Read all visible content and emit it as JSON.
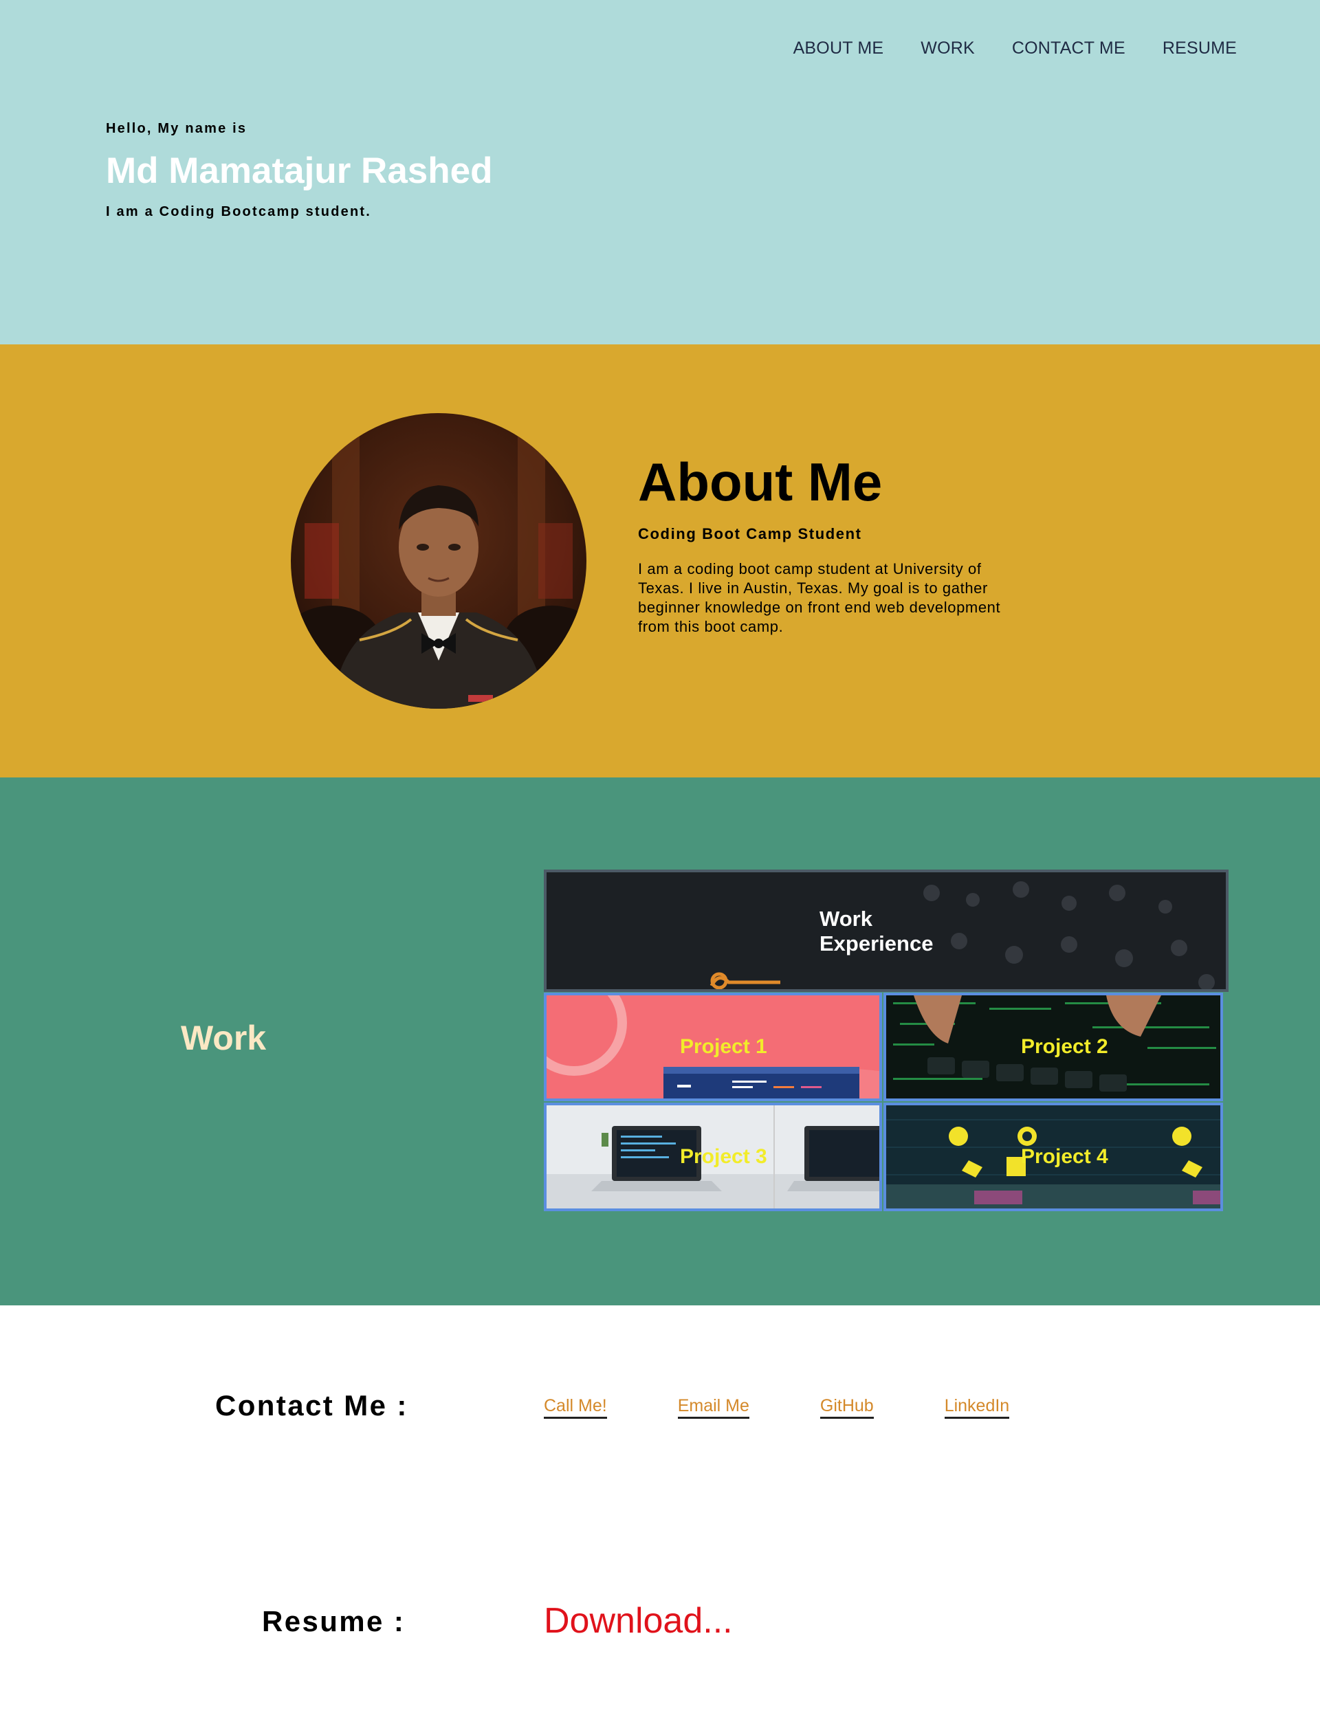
{
  "nav": {
    "items": [
      "ABOUT ME",
      "WORK",
      "CONTACT ME",
      "RESUME"
    ]
  },
  "hero": {
    "greeting": "Hello, My name is",
    "name": "Md Mamatajur Rashed",
    "tagline": "I am a Coding Bootcamp student."
  },
  "about": {
    "title": "About Me",
    "subtitle": "Coding Boot Camp Student",
    "text": "I am a coding boot camp student at University of Texas. I live in Austin, Texas. My goal is to gather beginner knowledge on front end web development from this boot camp."
  },
  "work": {
    "title": "Work",
    "experience_label": "Work Experience",
    "projects": [
      "Project 1",
      "Project 2",
      "Project 3",
      "Project 4"
    ]
  },
  "contact": {
    "title": "Contact Me :",
    "links": [
      "Call Me!",
      "Email Me",
      "GitHub",
      "LinkedIn"
    ]
  },
  "resume": {
    "title": "Resume :",
    "download": "Download..."
  },
  "colors": {
    "hero_bg": "#afdbda",
    "about_bg": "#d9a82e",
    "work_bg": "#4a957c",
    "work_title": "#fbe8c4",
    "project_label": "#f2ec2a",
    "link": "#d4892a",
    "download": "#e0121b"
  }
}
